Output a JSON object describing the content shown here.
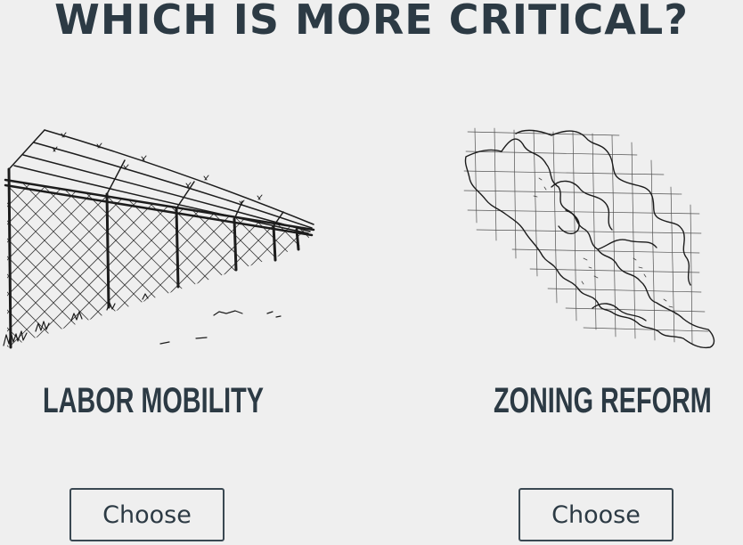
{
  "header": {
    "title": "WHICH IS MORE CRITICAL?"
  },
  "options": [
    {
      "label": "LABOR MOBILITY",
      "button_label": "Choose",
      "icon": "chain-link-fence-icon"
    },
    {
      "label": "ZONING REFORM",
      "button_label": "Choose",
      "icon": "zoning-map-icon"
    }
  ],
  "colors": {
    "background": "#efefef",
    "text": "#2c3a44",
    "ink": "#1c1c1c"
  }
}
